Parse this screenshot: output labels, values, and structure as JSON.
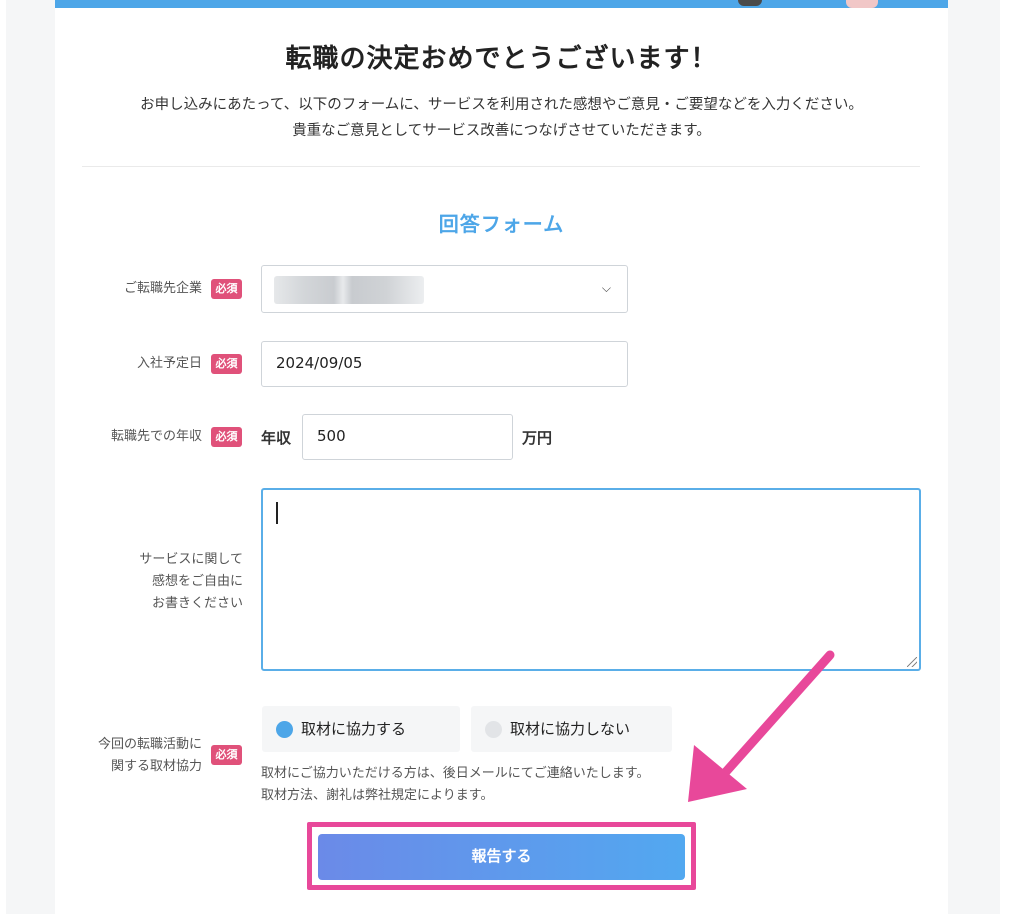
{
  "header": {
    "title": "転職の決定おめでとうございます！",
    "intro_line1": "お申し込みにあたって、以下のフォームに、サービスを利用された感想やご意見・ご要望などを入力ください。",
    "intro_line2": "貴重なご意見としてサービス改善につなげさせていただきます。"
  },
  "form": {
    "title": "回答フォーム",
    "required_badge": "必須",
    "company": {
      "label": "ご転職先企業",
      "value": ""
    },
    "start_date": {
      "label": "入社予定日",
      "value": "2024/09/05"
    },
    "income": {
      "label": "転職先での年収",
      "prefix": "年収",
      "value": "500",
      "unit": "万円"
    },
    "feedback": {
      "label_line1": "サービスに関して",
      "label_line2": "感想をご自由に",
      "label_line3": "お書きください",
      "value": ""
    },
    "interview": {
      "label_line1": "今回の転職活動に",
      "label_line2": "関する取材協力",
      "option_yes": "取材に協力する",
      "option_no": "取材に協力しない",
      "selected": "取材に協力する",
      "note_line1": "取材にご協力いただける方は、後日メールにてご連絡いたします。",
      "note_line2": "取材方法、謝礼は弊社規定によります。"
    },
    "submit_label": "報告する"
  },
  "colors": {
    "accent": "#4da6e8",
    "required": "#e0517a",
    "annotation": "#e8489a"
  }
}
